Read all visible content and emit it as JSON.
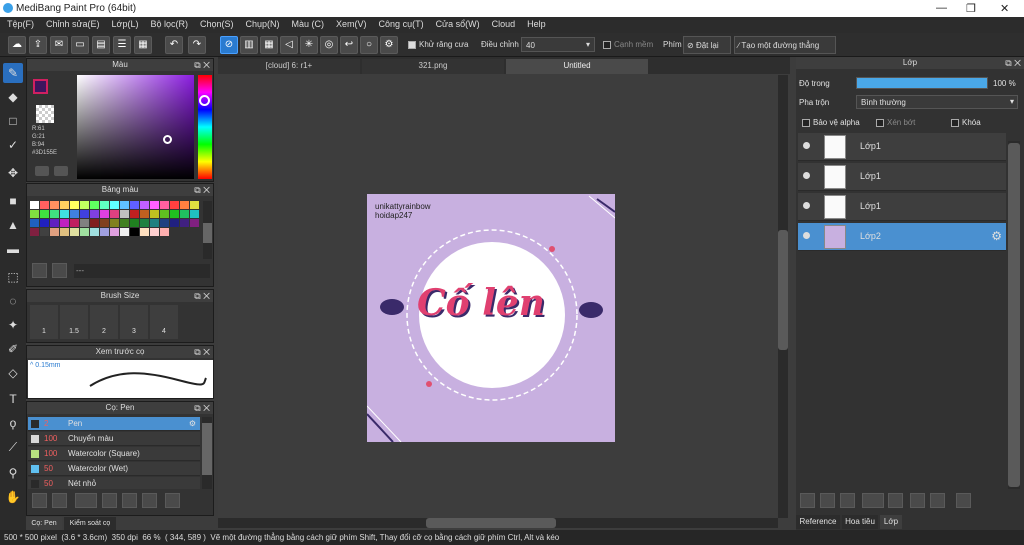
{
  "app": {
    "title": "MediBang Paint Pro (64bit)"
  },
  "window_controls": {
    "min": "—",
    "max": "❐",
    "close": "✕"
  },
  "menu": [
    "Tệp(F)",
    "Chỉnh sửa(E)",
    "Lớp(L)",
    "Bộ lọc(R)",
    "Chọn(S)",
    "Chụp(N)",
    "Màu (C)",
    "Xem(V)",
    "Công cụ(T)",
    "Cửa sổ(W)",
    "Cloud",
    "Help"
  ],
  "toolbar": {
    "antialias_label": "Khử răng cưa",
    "correction_label": "Điều chỉnh",
    "correction_value": "40",
    "edge_label": "Cạnh mềm",
    "keys_label": "Phím",
    "reset_label": "Đặt lại",
    "straight_label": "Tạo một đường thẳng"
  },
  "color_panel": {
    "title": "Màu",
    "r": "R:61",
    "g": "G:21",
    "b": "B:94",
    "hex": "#3D155E"
  },
  "palette_panel": {
    "title": "Bảng màu"
  },
  "brushsize_panel": {
    "title": "Brush Size",
    "sizes": [
      "1",
      "1.5",
      "2",
      "3",
      "4"
    ]
  },
  "preview_panel": {
    "title": "Xem trước cọ",
    "size": "^ 0.15mm"
  },
  "brush_panel": {
    "title": "Cọ: Pen",
    "items": [
      {
        "value": "2",
        "name": "Pen",
        "color": "#2a2a2a"
      },
      {
        "value": "100",
        "name": "Chuyển màu",
        "color": "#d8d8d8"
      },
      {
        "value": "100",
        "name": "Watercolor (Square)",
        "color": "#b8e080"
      },
      {
        "value": "50",
        "name": "Watercolor (Wet)",
        "color": "#60c0f0"
      },
      {
        "value": "50",
        "name": "Nét nhỏ",
        "color": "#2a2a2a"
      }
    ]
  },
  "bottom_tabs": {
    "brush": "Cọ: Pen",
    "control": "Kiểm soát cọ"
  },
  "doc_tabs": [
    "[cloud] 6: r1+",
    "321.png",
    "Untitled"
  ],
  "canvas": {
    "watermark1": "unikattyrainbow",
    "watermark2": "hoidap247",
    "art_text": "Cố lên"
  },
  "layer_panel": {
    "title": "Lớp",
    "opacity_label": "Độ trong",
    "opacity_value": "100 %",
    "opacity_pct": 100,
    "blend_label": "Pha trộn",
    "blend_value": "Bình thường",
    "protect_alpha": "Bảo vệ alpha",
    "clip": "Xén bớt",
    "lock": "Khóa",
    "layers": [
      "Lớp1",
      "Lớp1",
      "Lớp1",
      "Lớp2"
    ],
    "active_index": 3
  },
  "right_tabs": [
    "Reference",
    "Hoa tiêu",
    "Lớp"
  ],
  "status": {
    "size": "500 * 500 pixel",
    "cm": "(3.6 * 3.6cm)",
    "dpi": "350 dpi",
    "zoom": "66 %",
    "coords": "( 344, 589 )",
    "hint": "Vẽ một đường thẳng bằng cách giữ phím Shift, Thay đổi cỡ cọ bằng cách giữ phím Ctrl, Alt và kéo"
  },
  "colors": {
    "accent": "#2a7bd0",
    "canvas_bg": "#c8b0e0",
    "current_color": "#3D155E",
    "layer_active": "#4a90d0"
  }
}
